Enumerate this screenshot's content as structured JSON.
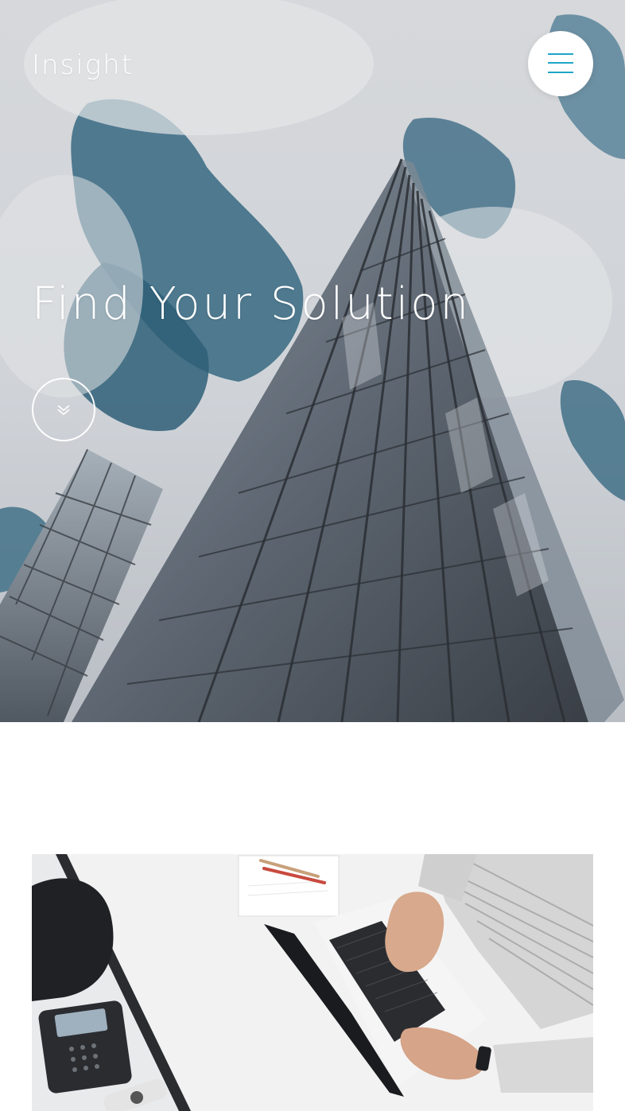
{
  "header": {
    "brand": "Insight",
    "menu_icon": "hamburger-menu-icon",
    "accent_color": "#1ea6c9"
  },
  "hero": {
    "title": "Find Your Solution",
    "scroll_icon": "double-chevron-down-icon",
    "background": "glass-skyscraper-against-cloudy-sky-photo"
  },
  "section": {
    "photo": "person-typing-on-laptop-at-white-desk-photo"
  }
}
